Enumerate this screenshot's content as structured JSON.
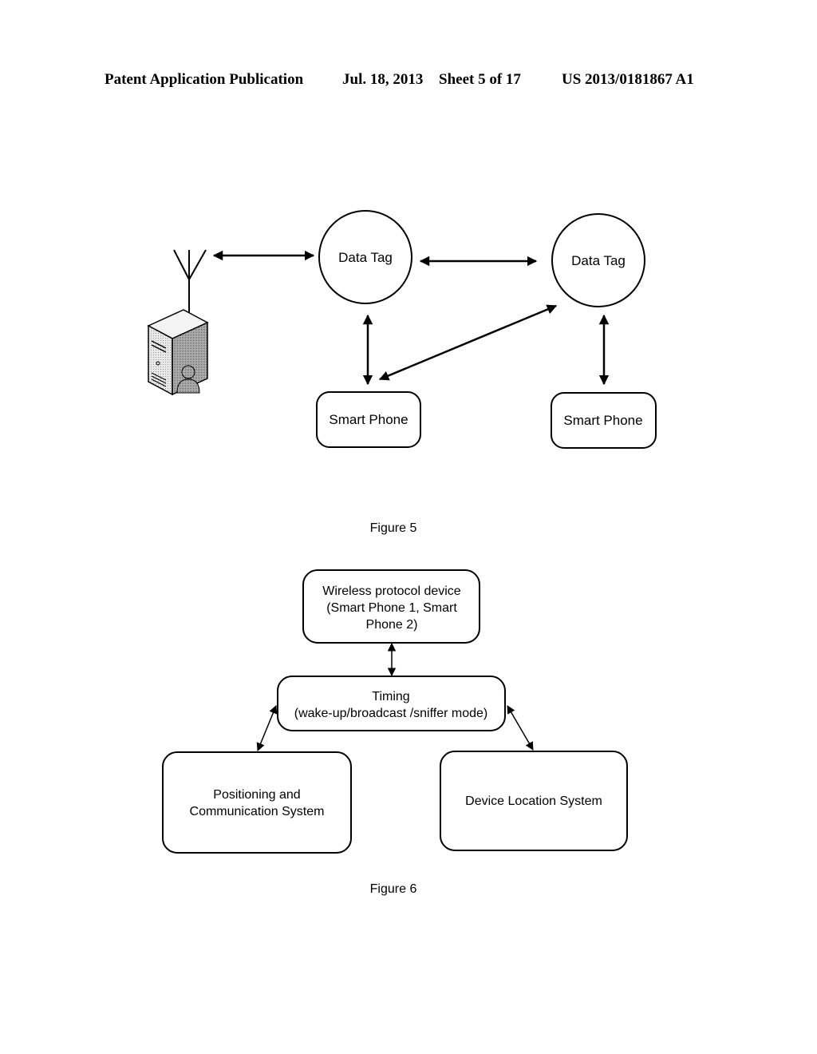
{
  "header": {
    "publication": "Patent Application Publication",
    "date": "Jul. 18, 2013",
    "sheet": "Sheet 5 of 17",
    "number": "US 2013/0181867 A1"
  },
  "figure5": {
    "caption": "Figure 5",
    "nodes": {
      "server": "server-with-antenna-icon",
      "data_tag_1": "Data Tag",
      "data_tag_2": "Data Tag",
      "smart_phone_1": "Smart Phone",
      "smart_phone_2": "Smart Phone"
    },
    "edges": [
      {
        "from": "server",
        "to": "data_tag_1",
        "type": "bidirectional"
      },
      {
        "from": "data_tag_1",
        "to": "data_tag_2",
        "type": "bidirectional"
      },
      {
        "from": "data_tag_1",
        "to": "smart_phone_1",
        "type": "bidirectional"
      },
      {
        "from": "data_tag_2",
        "to": "smart_phone_1",
        "type": "bidirectional"
      },
      {
        "from": "data_tag_2",
        "to": "smart_phone_2",
        "type": "bidirectional"
      }
    ]
  },
  "figure6": {
    "caption": "Figure 6",
    "nodes": {
      "wireless": [
        "Wireless protocol device",
        "(Smart Phone 1, Smart",
        "Phone 2)"
      ],
      "timing": [
        "Timing",
        "(wake-up/broadcast /sniffer mode)"
      ],
      "positioning": [
        "Positioning and",
        "Communication System"
      ],
      "device_location": [
        "Device Location System"
      ]
    },
    "edges": [
      {
        "from": "wireless",
        "to": "timing",
        "type": "bidirectional"
      },
      {
        "from": "timing",
        "to": "positioning",
        "type": "bidirectional"
      },
      {
        "from": "timing",
        "to": "device_location",
        "type": "bidirectional"
      }
    ]
  }
}
